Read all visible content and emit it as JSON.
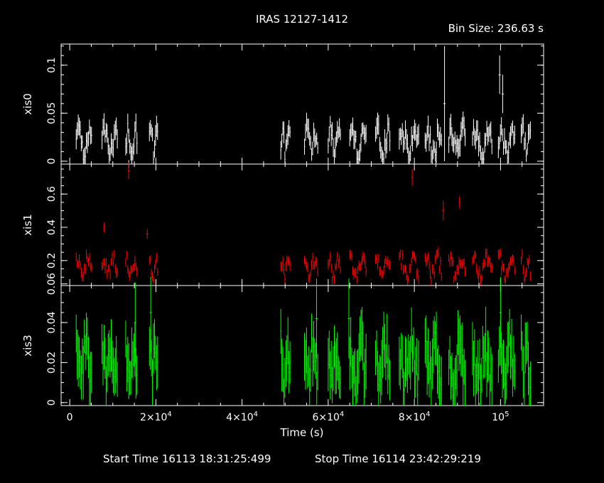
{
  "header": {
    "title": "IRAS 12127-1412",
    "bin_size": "Bin Size: 236.63 s"
  },
  "footer": {
    "start_time": "Start Time 16113 18:31:25:499",
    "stop_time": "Stop Time 16114 23:42:29:219"
  },
  "colors": {
    "background": "#000000",
    "axes": "#ffffff",
    "xis0": "#ffffff",
    "xis1": "#ff0000",
    "xis3": "#00ff00"
  },
  "chart_data": {
    "type": "scatter",
    "title": "IRAS 12127-1412",
    "xlabel": "Time (s)",
    "xlim": [
      -2000,
      110000
    ],
    "x_ticks": [
      {
        "value": 0,
        "label": "0"
      },
      {
        "value": 20000,
        "label": "2×10^4"
      },
      {
        "value": 40000,
        "label": "4×10^4"
      },
      {
        "value": 60000,
        "label": "6×10^4"
      },
      {
        "value": 80000,
        "label": "8×10^4"
      },
      {
        "value": 100000,
        "label": "10^5"
      }
    ],
    "bin_size_s": 236.63,
    "observation_intervals": [
      [
        1500,
        5200
      ],
      [
        7500,
        11200
      ],
      [
        13000,
        15800
      ],
      [
        18500,
        20500
      ],
      [
        49000,
        51300
      ],
      [
        54500,
        57600
      ],
      [
        60000,
        63000
      ],
      [
        65000,
        69000
      ],
      [
        71000,
        74500
      ],
      [
        76500,
        81000
      ],
      [
        82500,
        86500
      ],
      [
        88000,
        92000
      ],
      [
        93500,
        98000
      ],
      [
        99500,
        103500
      ],
      [
        104800,
        107000
      ]
    ],
    "panels": [
      {
        "name": "xis0",
        "ylabel": "xis0",
        "ylim": [
          -0.003,
          0.122
        ],
        "yticks": [
          0,
          0.05,
          0.1
        ],
        "ytick_labels": [
          "0",
          "0.05",
          "0.1"
        ],
        "minor_step": 0.01,
        "color": "#ffffff",
        "base": 0.02,
        "amp": 0.012,
        "noise": 0.011,
        "err_base": 0.006,
        "err_scale": 0.5,
        "spikes": [
          {
            "x": 87000,
            "y": 0.06,
            "err": 0.06
          },
          {
            "x": 99800,
            "y": 0.09,
            "err": 0.02
          },
          {
            "x": 100500,
            "y": 0.07,
            "err": 0.02
          },
          {
            "x": 13700,
            "y": -0.003,
            "err": 0.004
          }
        ]
      },
      {
        "name": "xis1",
        "ylabel": "xis1",
        "ylim": [
          0.05,
          0.78
        ],
        "yticks": [
          0.06,
          0.2,
          0.4,
          0.6
        ],
        "ytick_labels": [
          "0.06",
          "0.2",
          "0.4",
          "0.6"
        ],
        "minor_step": 0.05,
        "color": "#ff0000",
        "base": 0.16,
        "amp": 0.05,
        "noise": 0.045,
        "err_base": 0.022,
        "err_scale": 0.2,
        "spikes": [
          {
            "x": 13700,
            "y": 0.74,
            "err": 0.05
          },
          {
            "x": 79500,
            "y": 0.7,
            "err": 0.05
          },
          {
            "x": 86700,
            "y": 0.5,
            "err": 0.06
          },
          {
            "x": 90500,
            "y": 0.55,
            "err": 0.04
          },
          {
            "x": 8000,
            "y": 0.4,
            "err": 0.03
          },
          {
            "x": 18000,
            "y": 0.36,
            "err": 0.03
          }
        ]
      },
      {
        "name": "xis3",
        "ylabel": "xis3",
        "ylim": [
          -0.0015,
          0.0585
        ],
        "yticks": [
          0,
          0.02,
          0.04
        ],
        "ytick_labels": [
          "0",
          "0.02",
          "0.04"
        ],
        "minor_step": 0.005,
        "color": "#00ff00",
        "base": 0.02,
        "amp": 0.008,
        "noise": 0.01,
        "err_base": 0.008,
        "err_scale": 0.6,
        "spikes": [
          {
            "x": 15200,
            "y": 0.04,
            "err": 0.02
          },
          {
            "x": 18800,
            "y": 0.045,
            "err": 0.02
          },
          {
            "x": 57300,
            "y": 0.042,
            "err": 0.02
          },
          {
            "x": 64800,
            "y": 0.042,
            "err": 0.02
          },
          {
            "x": 100000,
            "y": 0.045,
            "err": 0.018
          }
        ]
      }
    ]
  }
}
